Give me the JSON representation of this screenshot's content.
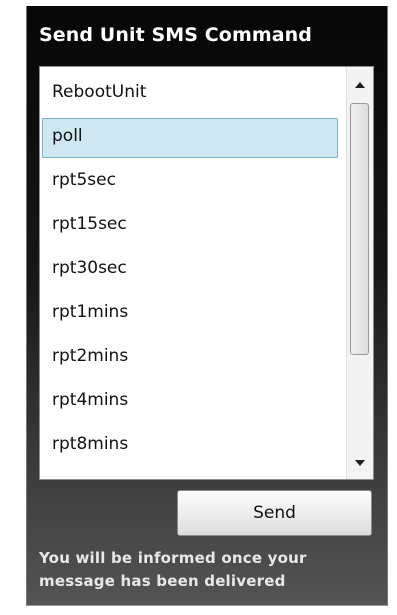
{
  "panel": {
    "title": "Send Unit SMS Command",
    "commands": [
      "RebootUnit",
      "poll",
      "rpt5sec",
      "rpt15sec",
      "rpt30sec",
      "rpt1mins",
      "rpt2mins",
      "rpt4mins",
      "rpt8mins"
    ],
    "selected_command": "poll",
    "send_label": "Send",
    "info_line1": "You will be informed once your",
    "info_line2": "message has been delivered"
  },
  "icons": {
    "scroll_up": "triangle-up-icon",
    "scroll_down": "triangle-down-icon"
  },
  "colors": {
    "selection_bg": "#cfe7f0",
    "selection_border": "#7ab3c8"
  }
}
